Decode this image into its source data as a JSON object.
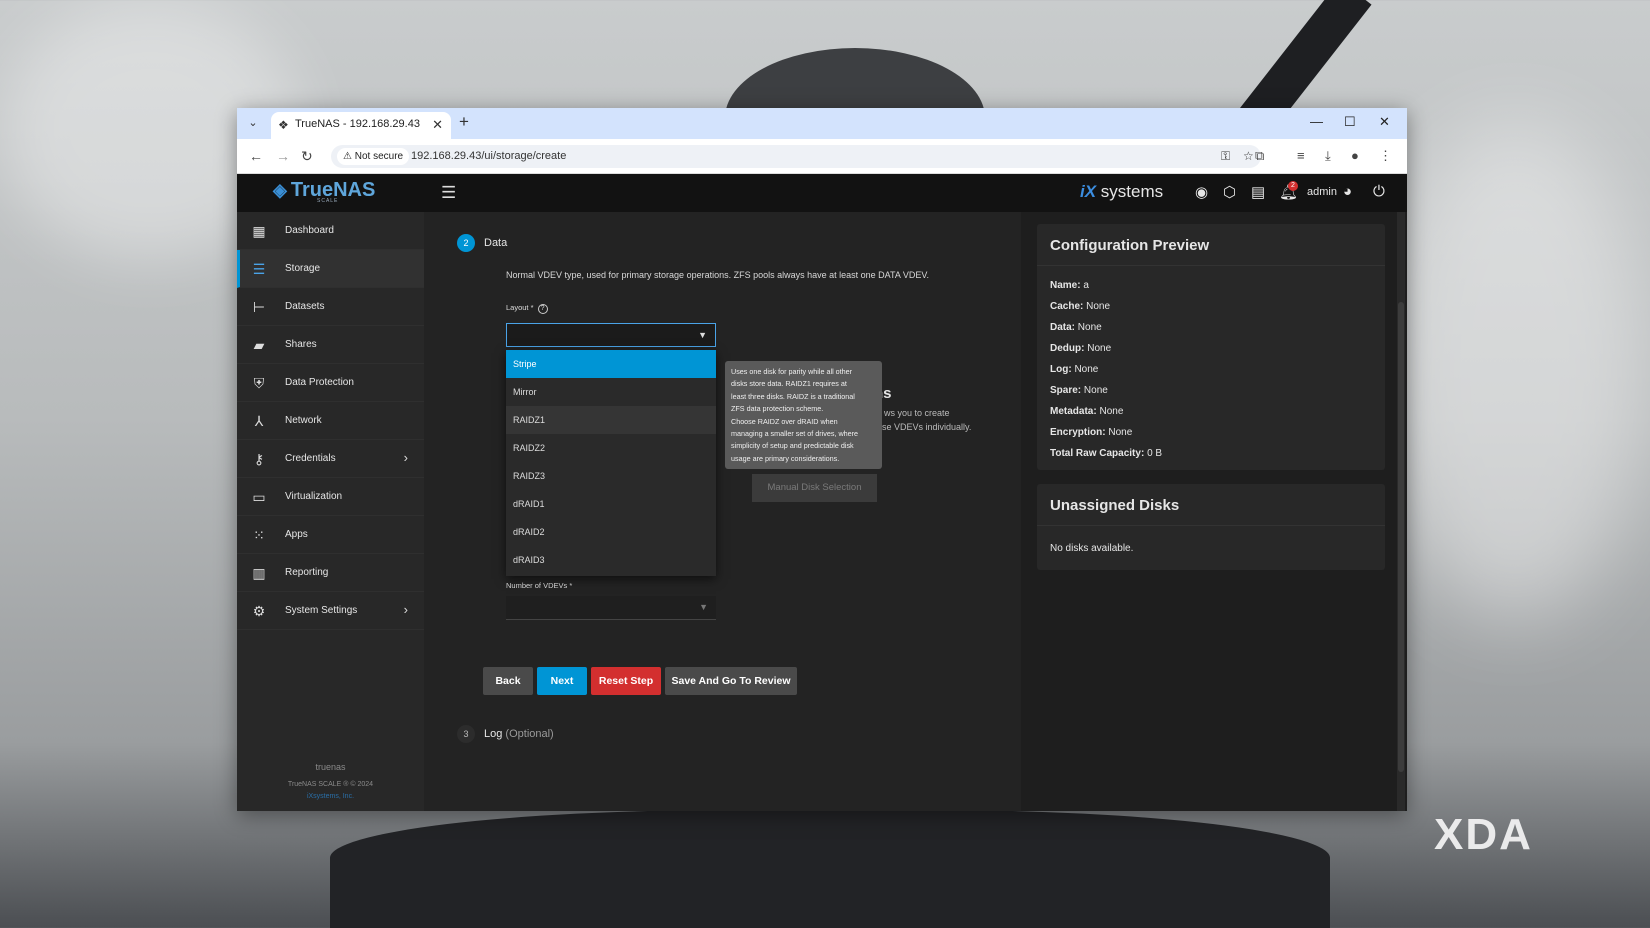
{
  "browser": {
    "tab_title": "TrueNAS - 192.168.29.43",
    "tab_close": "✕",
    "new_tab": "+",
    "security_label": "Not secure",
    "url": "192.168.29.43/ui/storage/create"
  },
  "topbar": {
    "logo_text": "TrueNAS",
    "logo_sub": "SCALE",
    "ix_brand": "systems",
    "ix_prefix": "iX",
    "alert_count": "2",
    "user": "admin"
  },
  "sidebar": {
    "items": [
      {
        "label": "Dashboard",
        "icon": "dashboard-icon"
      },
      {
        "label": "Storage",
        "icon": "storage-icon"
      },
      {
        "label": "Datasets",
        "icon": "datasets-icon"
      },
      {
        "label": "Shares",
        "icon": "shares-icon"
      },
      {
        "label": "Data Protection",
        "icon": "shield-icon"
      },
      {
        "label": "Network",
        "icon": "network-icon"
      },
      {
        "label": "Credentials",
        "icon": "key-icon"
      },
      {
        "label": "Virtualization",
        "icon": "monitor-icon"
      },
      {
        "label": "Apps",
        "icon": "apps-grid-icon"
      },
      {
        "label": "Reporting",
        "icon": "reporting-icon"
      },
      {
        "label": "System Settings",
        "icon": "gear-icon"
      }
    ],
    "hostname": "truenas",
    "copyright": "TrueNAS SCALE ® © 2024",
    "company": "iXsystems, Inc."
  },
  "wizard": {
    "step2_number": "2",
    "step2_title": "Data",
    "description": "Normal VDEV type, used for primary storage operations. ZFS pools always have at least one DATA VDEV.",
    "layout_label": "Layout *",
    "layout_help": "?",
    "layout_options": [
      "Stripe",
      "Mirror",
      "RAIDZ1",
      "RAIDZ2",
      "RAIDZ3",
      "dRAID1",
      "dRAID2",
      "dRAID3"
    ],
    "tooltip_lines": [
      "Uses one disk for parity while all other",
      "disks store data. RAIDZ1 requires at",
      "least three disks. RAIDZ is a traditional",
      "ZFS data protection scheme.",
      "Choose RAIDZ over dRAID when",
      "managing a smaller set of drives, where",
      "simplicity of setup and predictable disk",
      "usage are primary considerations."
    ],
    "partial_heading": "ns",
    "partial_text_1": "ws you to create",
    "partial_text_2": "ose VDEVs individually.",
    "manual_button": "Manual Disk Selection",
    "vdevs_label": "Number of VDEVs *",
    "buttons": {
      "back": "Back",
      "next": "Next",
      "reset": "Reset Step",
      "review": "Save And Go To Review"
    },
    "step3_number": "3",
    "step3_title": "Log",
    "step3_optional": "(Optional)"
  },
  "config_preview": {
    "title": "Configuration Preview",
    "rows": [
      {
        "key": "Name:",
        "value": "a"
      },
      {
        "key": "Cache:",
        "value": "None"
      },
      {
        "key": "Data:",
        "value": "None"
      },
      {
        "key": "Dedup:",
        "value": "None"
      },
      {
        "key": "Log:",
        "value": "None"
      },
      {
        "key": "Spare:",
        "value": "None"
      },
      {
        "key": "Metadata:",
        "value": "None"
      },
      {
        "key": "Encryption:",
        "value": "None"
      },
      {
        "key": "Total Raw Capacity:",
        "value": "0 B"
      }
    ]
  },
  "unassigned": {
    "title": "Unassigned Disks",
    "message": "No disks available."
  },
  "watermark": "XDA",
  "colors": {
    "accent": "#0095d5",
    "reset": "#d32f2f",
    "neutral_button": "#4a4a4a"
  }
}
